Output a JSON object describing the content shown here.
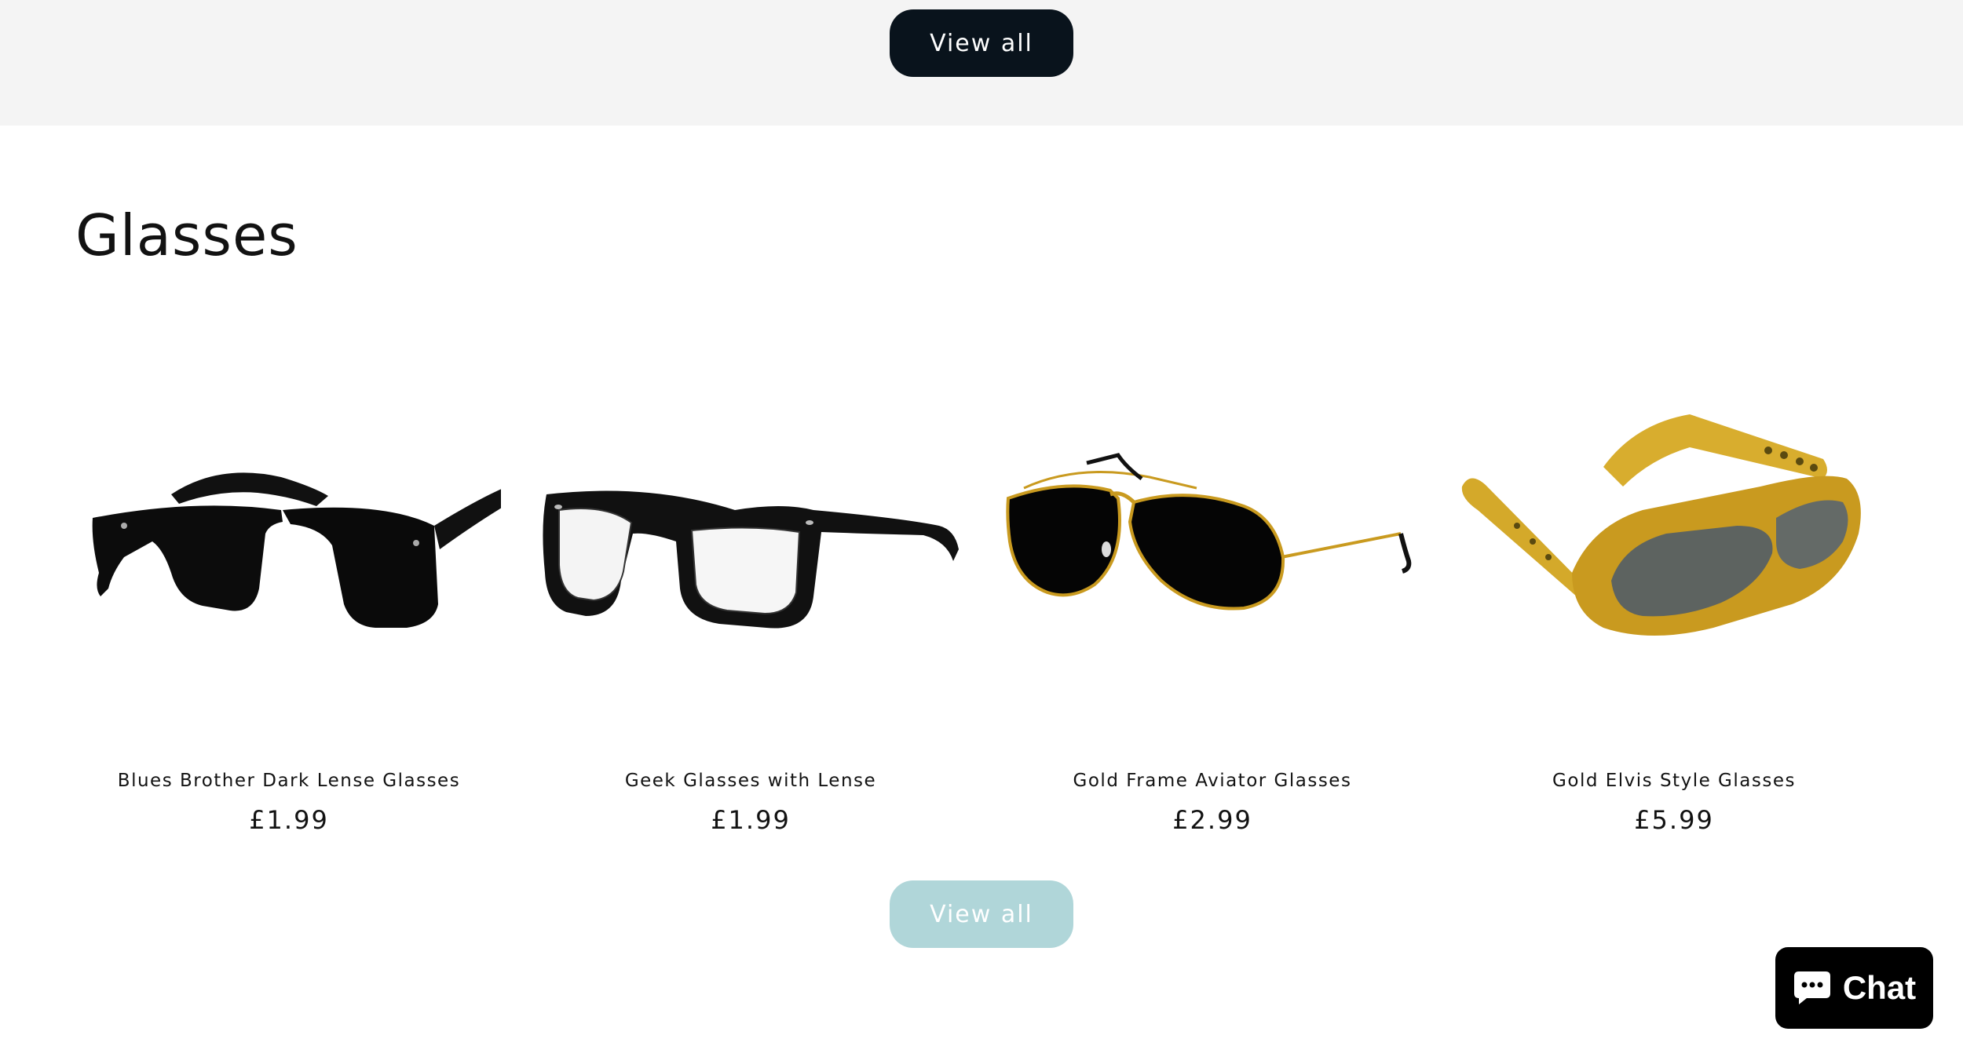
{
  "top_section": {
    "view_all_label": "View all"
  },
  "glasses_section": {
    "title": "Glasses",
    "products": [
      {
        "name": "Blues Brother Dark Lense Glasses",
        "price": "£1.99",
        "image": "black-wayfarer-sunglasses"
      },
      {
        "name": "Geek Glasses with Lense",
        "price": "£1.99",
        "image": "black-clear-lens-glasses"
      },
      {
        "name": "Gold Frame Aviator Glasses",
        "price": "£2.99",
        "image": "gold-aviator-sunglasses"
      },
      {
        "name": "Gold Elvis Style Glasses",
        "price": "£5.99",
        "image": "gold-elvis-glasses"
      }
    ],
    "view_all_label": "View all"
  },
  "chat_widget": {
    "label": "Chat",
    "icon": "chat-bubble-icon"
  },
  "colors": {
    "top_band": "#f4f4f4",
    "button_dark": "#09131c",
    "button_light": "#b0d6d9",
    "text": "#121212",
    "chat_bg": "#000000",
    "gold": "#c99a1f"
  }
}
